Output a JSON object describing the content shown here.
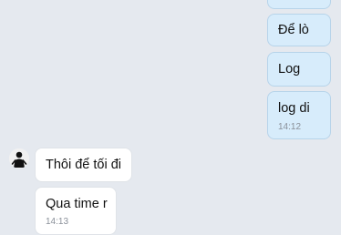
{
  "messages": {
    "sent": [
      {
        "text": ""
      },
      {
        "text": "Để lò"
      },
      {
        "text": "Log"
      },
      {
        "text": "log di",
        "time": "14:12"
      }
    ],
    "received": [
      {
        "text": "Thôi để tối đi"
      },
      {
        "text": "Qua time r",
        "time": "14:13"
      }
    ]
  },
  "colors": {
    "background": "#e5e9ef",
    "outgoing_bubble": "#d7ecfb",
    "incoming_bubble": "#ffffff"
  }
}
